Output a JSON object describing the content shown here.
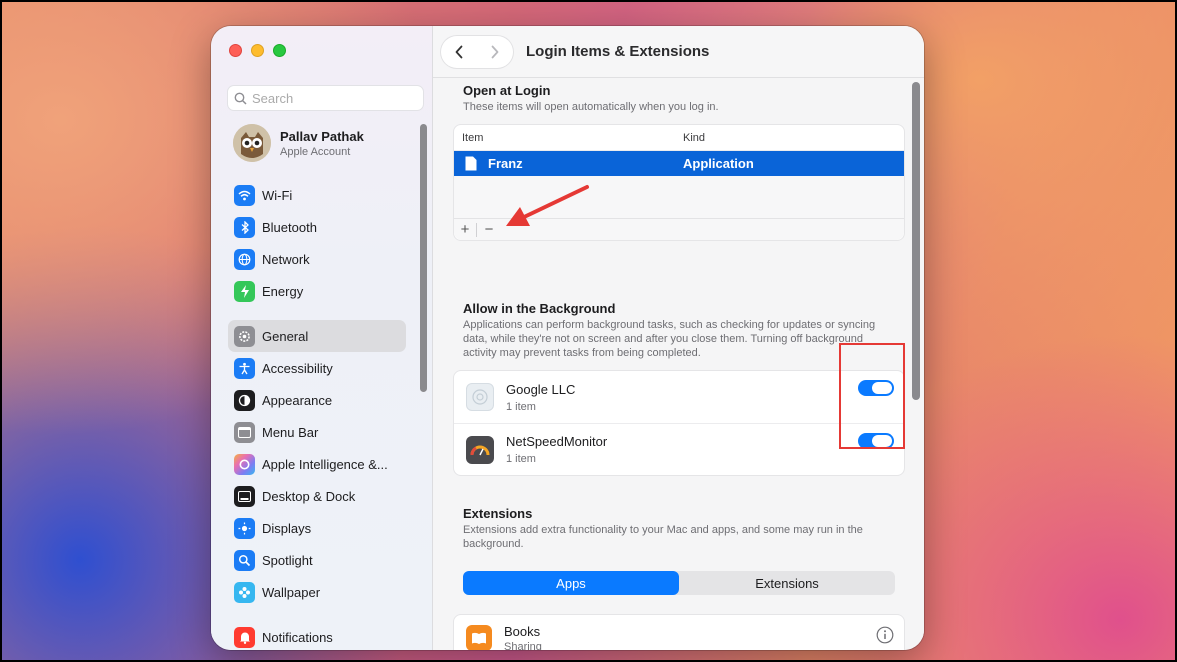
{
  "sidebar": {
    "search_placeholder": "Search",
    "account": {
      "name": "Pallav Pathak",
      "subtitle": "Apple Account"
    },
    "items": [
      {
        "label": "Wi-Fi",
        "icon": "wifi-icon",
        "color": "#1b7cf5"
      },
      {
        "label": "Bluetooth",
        "icon": "bluetooth-icon",
        "color": "#1b7cf5"
      },
      {
        "label": "Network",
        "icon": "globe-icon",
        "color": "#1b7cf5"
      },
      {
        "label": "Energy",
        "icon": "battery-bolt-icon",
        "color": "#34c759"
      },
      {
        "label": "General",
        "icon": "gear-icon",
        "color": "#8e8e93",
        "active": true
      },
      {
        "label": "Accessibility",
        "icon": "accessibility-icon",
        "color": "#1b7cf5"
      },
      {
        "label": "Appearance",
        "icon": "appearance-icon",
        "color": "#1d1d1f"
      },
      {
        "label": "Menu Bar",
        "icon": "menubar-icon",
        "color": "#8e8e93"
      },
      {
        "label": "Apple Intelligence &...",
        "icon": "apple-intelligence-icon",
        "color": "#e86fb3"
      },
      {
        "label": "Desktop & Dock",
        "icon": "dock-icon",
        "color": "#1d1d1f"
      },
      {
        "label": "Displays",
        "icon": "sun-icon",
        "color": "#1b7cf5"
      },
      {
        "label": "Spotlight",
        "icon": "spotlight-icon",
        "color": "#1b7cf5"
      },
      {
        "label": "Wallpaper",
        "icon": "flower-icon",
        "color": "#36b7f0"
      },
      {
        "label": "Notifications",
        "icon": "bell-icon",
        "color": "#ff3b30"
      }
    ]
  },
  "toolbar": {
    "title": "Login Items & Extensions"
  },
  "open_at_login": {
    "heading": "Open at Login",
    "description": "These items will open automatically when you log in.",
    "col_item": "Item",
    "col_kind": "Kind",
    "rows": [
      {
        "item": "Franz",
        "kind": "Application"
      }
    ],
    "add_label": "+",
    "remove_label": "−"
  },
  "background": {
    "heading": "Allow in the Background",
    "description": "Applications can perform background tasks, such as checking for updates or syncing data, while they're not on screen and after you close them. Turning off background activity may prevent tasks from being completed.",
    "items": [
      {
        "name": "Google LLC",
        "sub": "1 item",
        "enabled": true
      },
      {
        "name": "NetSpeedMonitor",
        "sub": "1 item",
        "enabled": true
      }
    ]
  },
  "extensions": {
    "heading": "Extensions",
    "description": "Extensions add extra functionality to your Mac and apps, and some may run in the background.",
    "tabs": [
      {
        "label": "Apps",
        "selected": true
      },
      {
        "label": "Extensions",
        "selected": false
      }
    ],
    "items": [
      {
        "name": "Books",
        "sub": "Sharing"
      }
    ]
  },
  "colors": {
    "accent": "#0a7aff",
    "selection": "#0a64d8",
    "annotation": "#e53935"
  }
}
